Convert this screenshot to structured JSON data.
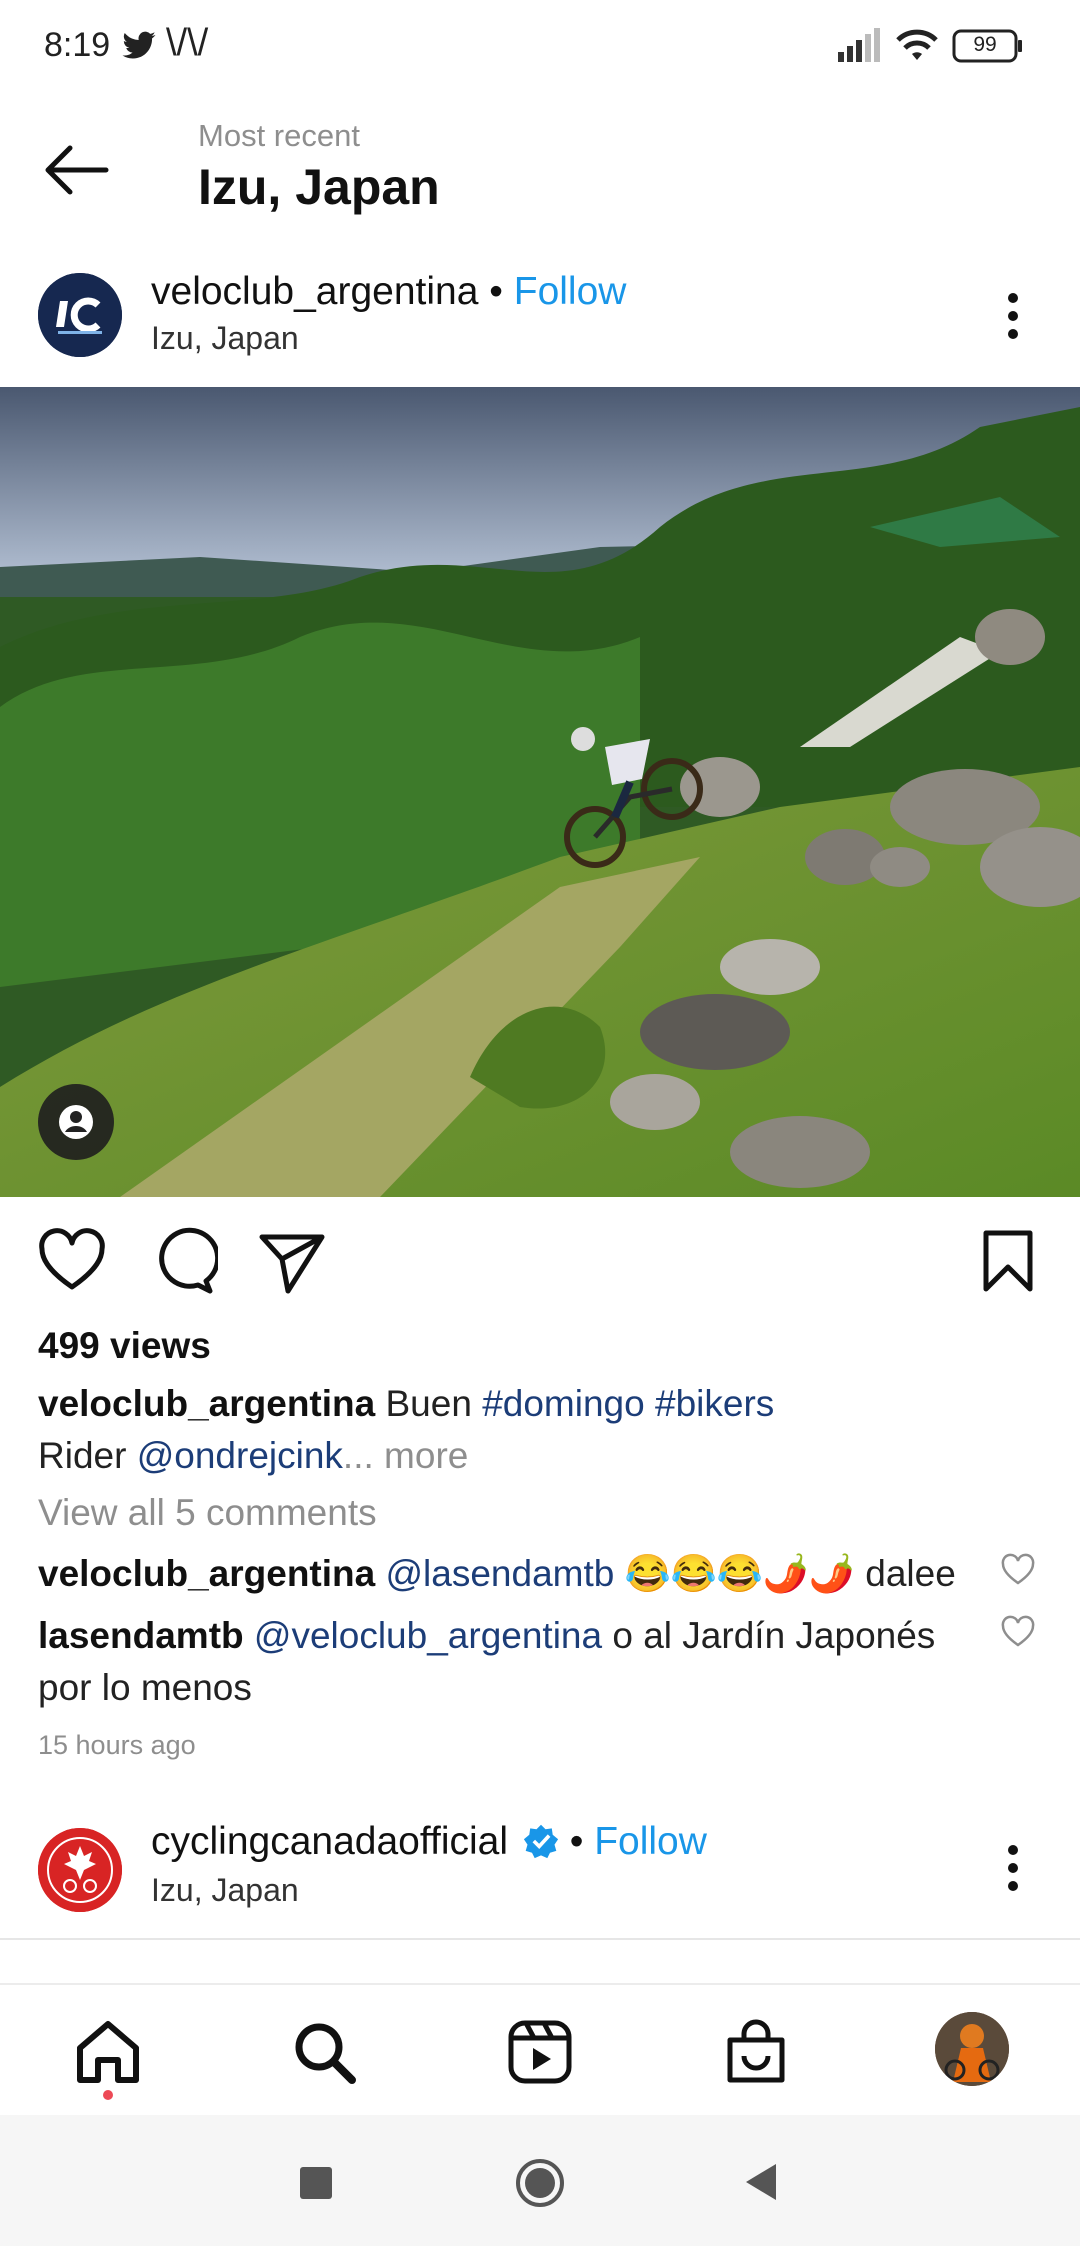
{
  "status_bar": {
    "time": "8:19",
    "carrier_glyph": "\\/\\/",
    "battery": "99"
  },
  "header": {
    "subtitle": "Most recent",
    "title": "Izu, Japan"
  },
  "post1": {
    "username": "veloclub_argentina",
    "separator": "•",
    "follow_label": "Follow",
    "location": "Izu, Japan",
    "views": "499 views",
    "caption_user": "veloclub_argentina",
    "caption_text": " Buen ",
    "tag1": "#domingo",
    "tag2": "#bikers",
    "caption_line2_prefix": "Rider ",
    "mention": "@ondrejcink",
    "ellipsis": "...",
    "more_label": " more",
    "view_all_comments": "View all 5 comments",
    "comments": [
      {
        "user": "veloclub_argentina",
        "mention": "@lasendamtb",
        "emojis": "😂😂😂🌶️🌶️",
        "text": " dalee"
      },
      {
        "user": "lasendamtb",
        "mention": "@veloclub_argentina",
        "text": " o al Jardín Japonés por lo menos"
      }
    ],
    "time_ago": "15 hours ago"
  },
  "post2": {
    "username": "cyclingcanadaofficial",
    "separator": "•",
    "follow_label": "Follow",
    "location": "Izu, Japan"
  },
  "icons": {
    "back": "arrow-left-icon",
    "like": "heart-icon",
    "comment": "comment-icon",
    "share": "send-icon",
    "save": "bookmark-icon",
    "home": "home-icon",
    "search": "search-icon",
    "reels": "reels-icon",
    "shop": "shop-icon"
  },
  "colors": {
    "follow": "#1996e8",
    "hashtag": "#1c3d78",
    "muted": "#8e8e8e",
    "notification_dot": "#ed4956",
    "verified": "#1996e8"
  }
}
